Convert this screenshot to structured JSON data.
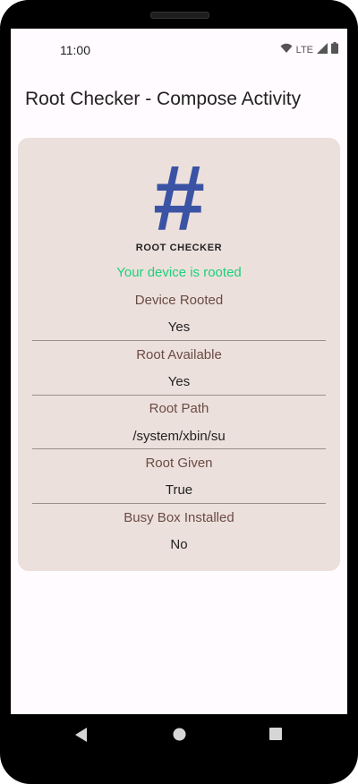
{
  "status_bar": {
    "time": "11:00",
    "network": "LTE"
  },
  "app_bar": {
    "title": "Root Checker  - Compose Activity"
  },
  "card": {
    "icon": "hash-icon",
    "icon_glyph": "#",
    "title": "ROOT CHECKER",
    "status_message": "Your device is rooted",
    "status_color": "#1ed07a",
    "rows": [
      {
        "label": "Device Rooted",
        "value": "Yes"
      },
      {
        "label": "Root Available",
        "value": "Yes"
      },
      {
        "label": "Root Path",
        "value": "/system/xbin/su"
      },
      {
        "label": "Root Given",
        "value": "True"
      },
      {
        "label": "Busy Box Installed",
        "value": "No"
      }
    ]
  },
  "nav_bar": {
    "back": "back-icon",
    "home": "home-icon",
    "recents": "recents-icon"
  }
}
